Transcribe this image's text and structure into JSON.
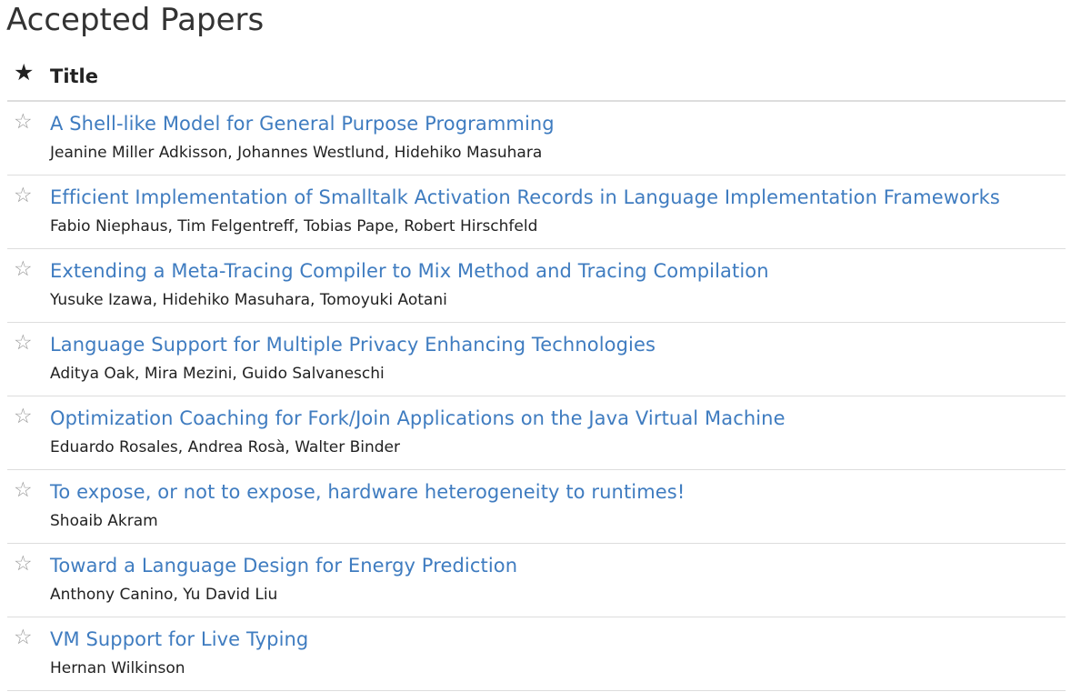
{
  "page": {
    "title": "Accepted Papers"
  },
  "table": {
    "header": {
      "star_icon": "star-filled-icon",
      "star_glyph": "★",
      "title_label": "Title"
    },
    "star_glyph": "☆",
    "rows": [
      {
        "title": "A Shell-like Model for General Purpose Programming",
        "authors": "Jeanine Miller Adkisson, Johannes Westlund, Hidehiko Masuhara"
      },
      {
        "title": "Efficient Implementation of Smalltalk Activation Records in Language Implementation Frameworks",
        "authors": "Fabio Niephaus, Tim Felgentreff, Tobias Pape, Robert Hirschfeld"
      },
      {
        "title": "Extending a Meta-Tracing Compiler to Mix Method and Tracing Compilation",
        "authors": "Yusuke Izawa, Hidehiko Masuhara, Tomoyuki Aotani"
      },
      {
        "title": "Language Support for Multiple Privacy Enhancing Technologies",
        "authors": "Aditya Oak, Mira Mezini, Guido Salvaneschi"
      },
      {
        "title": "Optimization Coaching for Fork/Join Applications on the Java Virtual Machine",
        "authors": "Eduardo Rosales, Andrea Rosà, Walter Binder"
      },
      {
        "title": "To expose, or not to expose, hardware heterogeneity to runtimes!",
        "authors": "Shoaib Akram"
      },
      {
        "title": "Toward a Language Design for Energy Prediction",
        "authors": "Anthony Canino, Yu David Liu"
      },
      {
        "title": "VM Support for Live Typing",
        "authors": "Hernan Wilkinson"
      }
    ]
  },
  "colors": {
    "link": "#3f7cc0",
    "text": "#222222",
    "star_outline": "#999999",
    "divider": "#dddddd"
  }
}
